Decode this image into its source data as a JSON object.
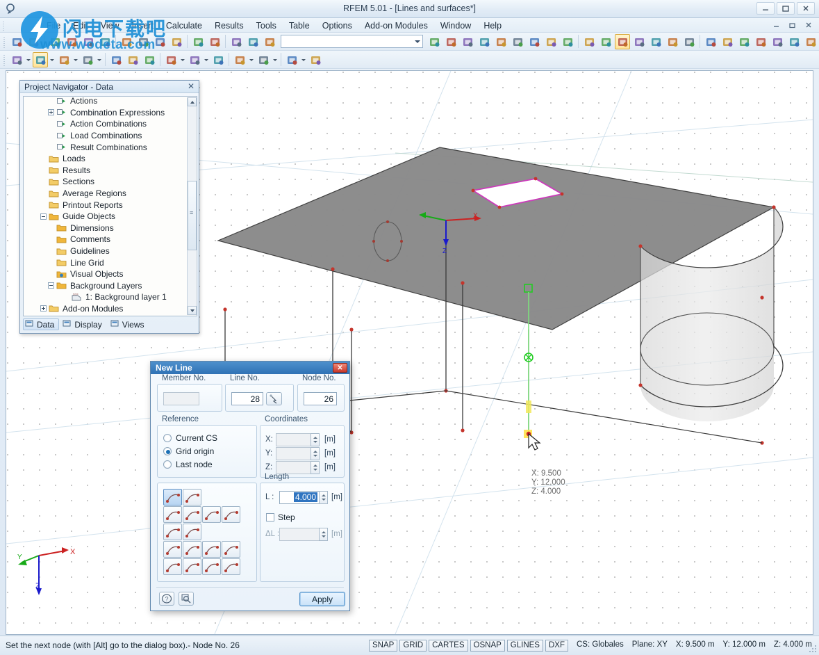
{
  "window": {
    "title": "RFEM 5.01 - [Lines and surfaces*]",
    "app_icon": "rfem-app-icon",
    "minimize": "minimize-icon",
    "maximize": "maximize-icon",
    "close": "close-icon"
  },
  "menu": {
    "items": [
      {
        "label": "File"
      },
      {
        "label": "Edit"
      },
      {
        "label": "View"
      },
      {
        "label": "Insert"
      },
      {
        "label": "Calculate"
      },
      {
        "label": "Results"
      },
      {
        "label": "Tools"
      },
      {
        "label": "Table"
      },
      {
        "label": "Options"
      },
      {
        "label": "Add-on Modules"
      },
      {
        "label": "Window"
      },
      {
        "label": "Help"
      }
    ]
  },
  "toolbar1": {
    "combo_value": "",
    "icons": [
      "new-file-icon",
      "open-folder-icon",
      "save-icon",
      "save-all-icon",
      "print-icon",
      "print-preview-icon",
      "cut-icon",
      "copy-icon",
      "undo-icon",
      "redo-icon",
      "refresh-icon",
      "stop-icon",
      "edit-table-icon",
      "table-icon",
      "details-icon"
    ],
    "nav_icons": [
      "previous-arrow-icon",
      "next-arrow-icon",
      "zoom-in-icon",
      "zoom-window-icon",
      "zoom-out-icon",
      "zoom-all-icon",
      "render-icon",
      "wireframe-icon",
      "grid-view-icon"
    ],
    "right_icons": [
      "model-view-icon",
      "sun-view-icon",
      "rotate-view-icon",
      "pan-view-icon",
      "perspective-icon",
      "section-icon",
      "dimension-icon",
      "snap-icon",
      "mirror-icon",
      "scale-icon",
      "intersect-icon",
      "rotate-object-icon",
      "info-icon",
      "settings-icon"
    ],
    "active_icon_index": 2
  },
  "toolbar2": {
    "icons": [
      "new-node-icon",
      "new-line-icon",
      "line-dimension-icon",
      "polyline-icon",
      "new-member-icon",
      "new-support-icon",
      "new-surface-icon",
      "new-solid-icon",
      "new-opening-icon",
      "new-load-icon",
      "surface-load-icon",
      "member-load-icon",
      "free-load-icon",
      "generate-icon"
    ],
    "active_icon_index": 1
  },
  "navigator": {
    "title": "Project Navigator - Data",
    "close_icon": "close-icon",
    "tree": [
      {
        "label": "Actions",
        "indent": 3,
        "expander": "none",
        "icon": "action-icon"
      },
      {
        "label": "Combination Expressions",
        "indent": 3,
        "expander": "plus",
        "icon": "combination-icon"
      },
      {
        "label": "Action Combinations",
        "indent": 3,
        "expander": "none",
        "icon": "action-combination-icon"
      },
      {
        "label": "Load Combinations",
        "indent": 3,
        "expander": "none",
        "icon": "load-combination-icon"
      },
      {
        "label": "Result Combinations",
        "indent": 3,
        "expander": "none",
        "icon": "result-combination-icon"
      },
      {
        "label": "Loads",
        "indent": 2,
        "expander": "none",
        "icon": "folder-icon"
      },
      {
        "label": "Results",
        "indent": 2,
        "expander": "none",
        "icon": "folder-icon"
      },
      {
        "label": "Sections",
        "indent": 2,
        "expander": "none",
        "icon": "folder-icon"
      },
      {
        "label": "Average Regions",
        "indent": 2,
        "expander": "none",
        "icon": "folder-icon"
      },
      {
        "label": "Printout Reports",
        "indent": 2,
        "expander": "none",
        "icon": "folder-icon"
      },
      {
        "label": "Guide Objects",
        "indent": 2,
        "expander": "minus",
        "icon": "folder-open-icon"
      },
      {
        "label": "Dimensions",
        "indent": 3,
        "expander": "none",
        "icon": "folder-yellow-icon"
      },
      {
        "label": "Comments",
        "indent": 3,
        "expander": "none",
        "icon": "folder-yellow-icon"
      },
      {
        "label": "Guidelines",
        "indent": 3,
        "expander": "none",
        "icon": "folder-icon"
      },
      {
        "label": "Line Grid",
        "indent": 3,
        "expander": "none",
        "icon": "folder-icon"
      },
      {
        "label": "Visual Objects",
        "indent": 3,
        "expander": "none",
        "icon": "visual-objects-icon"
      },
      {
        "label": "Background Layers",
        "indent": 3,
        "expander": "minus",
        "icon": "folder-yellow-icon"
      },
      {
        "label": "1: Background layer 1",
        "indent": 5,
        "expander": "none",
        "icon": "dxf-layer-icon"
      },
      {
        "label": "Add-on Modules",
        "indent": 2,
        "expander": "plus",
        "icon": "folder-icon"
      }
    ],
    "tabs": [
      {
        "label": "Data",
        "icon": "data-tab-icon",
        "selected": true
      },
      {
        "label": "Display",
        "icon": "display-tab-icon",
        "selected": false
      },
      {
        "label": "Views",
        "icon": "views-tab-icon",
        "selected": false
      }
    ]
  },
  "dialog": {
    "title": "New Line",
    "close_icon": "close-icon",
    "member_no": {
      "label": "Member No.",
      "value": ""
    },
    "line_no": {
      "label": "Line No.",
      "value": "28",
      "picker_icon": "pick-line-icon"
    },
    "node_no": {
      "label": "Node No.",
      "value": "26"
    },
    "reference": {
      "label": "Reference",
      "options": [
        {
          "label": "Current CS",
          "selected": false
        },
        {
          "label": "Grid origin",
          "selected": true
        },
        {
          "label": "Last node",
          "selected": false
        }
      ]
    },
    "coordinates": {
      "label": "Coordinates",
      "unit": "[m]",
      "fields": [
        {
          "label": "X:",
          "value": ""
        },
        {
          "label": "Y:",
          "value": ""
        },
        {
          "label": "Z:",
          "value": ""
        }
      ]
    },
    "length": {
      "label": "Length",
      "field_label": "L :",
      "value": "4.000",
      "unit": "[m]",
      "step": {
        "label": "Step",
        "checked": false,
        "field_label": "ΔL :",
        "value": "",
        "unit": "[m]"
      }
    },
    "line_types": [
      {
        "icon": "straight-line-icon",
        "selected": true
      },
      {
        "icon": "polyline-icon",
        "selected": false
      },
      {
        "icon": "arc-3points-icon",
        "selected": false
      },
      {
        "icon": "arc-center-icon",
        "selected": false
      },
      {
        "icon": "arc-tangent-icon",
        "selected": false
      },
      {
        "icon": "spline-icon",
        "selected": false
      },
      {
        "icon": "circle-icon",
        "selected": false
      },
      {
        "icon": "circle-center-icon",
        "selected": false
      },
      {
        "icon": "ellipse-icon",
        "selected": false
      },
      {
        "icon": "elliptical-arc-icon",
        "selected": false
      },
      {
        "icon": "parabola-icon",
        "selected": false
      },
      {
        "icon": "hyperbola-icon",
        "selected": false
      },
      {
        "icon": "nurbs-icon",
        "selected": false
      },
      {
        "icon": "bezier-icon",
        "selected": false
      },
      {
        "icon": "spiral-icon",
        "selected": false
      },
      {
        "icon": "line-on-surface-icon",
        "selected": false
      }
    ],
    "help_button": {
      "icon": "help-icon"
    },
    "inspect_button": {
      "icon": "magnifier-icon"
    },
    "apply_button": {
      "label": "Apply"
    }
  },
  "viewport": {
    "coord_tip": {
      "x": "X:  9.500",
      "y": "Y: 12.000",
      "z": "Z:  4.000"
    },
    "axis_triad": {
      "x": "X",
      "y": "Y",
      "z": "Z"
    },
    "model_z_label": "Z",
    "model_x_label": "X",
    "cursor_icon": "mouse-cursor-icon"
  },
  "statusbar": {
    "message": "Set the next node (with [Alt] go to the dialog box).- Node No. 26",
    "flags": [
      "SNAP",
      "GRID",
      "CARTES",
      "OSNAP",
      "GLINES",
      "DXF"
    ],
    "info": [
      "CS: Globales",
      "Plane: XY",
      "X:  9.500 m",
      "Y:  12.000 m",
      "Z:  4.000 m"
    ]
  },
  "watermark": {
    "chinese": "闪电下载吧",
    "url": "www.wodeta.com"
  },
  "colors": {
    "title_accent": "#2f72b5",
    "selection": "#1a6fb5",
    "node_red": "#c4342b",
    "opening_magenta": "#cc3bbb",
    "axis_green": "#17aa17",
    "axis_blue": "#1a1acc",
    "slab_gray": "#8a8a8a"
  }
}
